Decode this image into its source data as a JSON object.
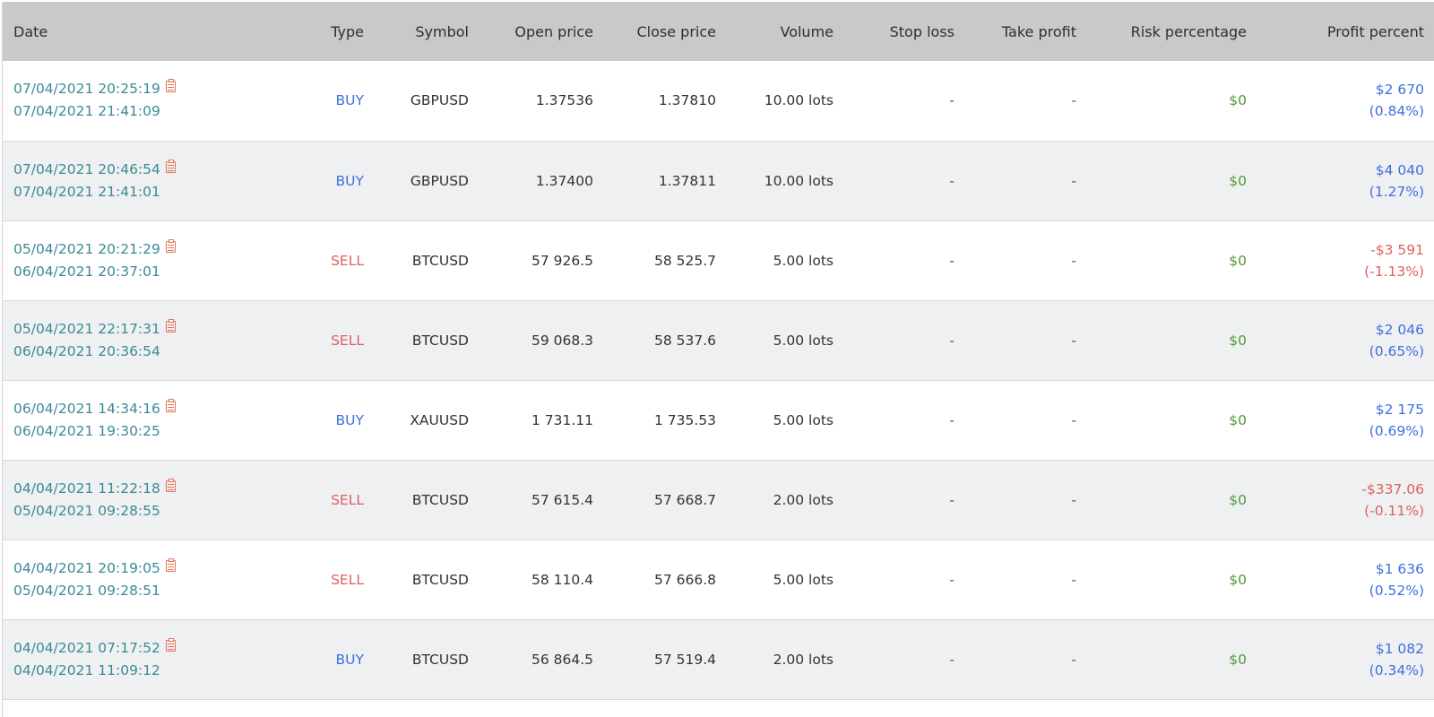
{
  "headers": {
    "date": "Date",
    "type": "Type",
    "symbol": "Symbol",
    "open_price": "Open price",
    "close_price": "Close price",
    "volume": "Volume",
    "stop_loss": "Stop loss",
    "take_profit": "Take profit",
    "risk": "Risk percentage",
    "profit": "Profit percent"
  },
  "colors": {
    "buy": "#3f6fe0",
    "sell": "#e06060",
    "risk": "#4f9a3a",
    "date": "#3b8a96",
    "header_bg": "#c9c9c9",
    "row_alt_bg": "#eff0f1"
  },
  "icons": {
    "date_icon": "document-icon"
  },
  "rows": [
    {
      "open_date": "07/04/2021 20:25:19",
      "close_date": "07/04/2021 21:41:09",
      "type": "BUY",
      "symbol": "GBPUSD",
      "open_price": "1.37536",
      "close_price": "1.37810",
      "volume": "10.00 lots",
      "stop_loss": "-",
      "take_profit": "-",
      "risk": "$0",
      "profit": "$2 670",
      "profit_pct": "(0.84%)"
    },
    {
      "open_date": "07/04/2021 20:46:54",
      "close_date": "07/04/2021 21:41:01",
      "type": "BUY",
      "symbol": "GBPUSD",
      "open_price": "1.37400",
      "close_price": "1.37811",
      "volume": "10.00 lots",
      "stop_loss": "-",
      "take_profit": "-",
      "risk": "$0",
      "profit": "$4 040",
      "profit_pct": "(1.27%)"
    },
    {
      "open_date": "05/04/2021 20:21:29",
      "close_date": "06/04/2021 20:37:01",
      "type": "SELL",
      "symbol": "BTCUSD",
      "open_price": "57 926.5",
      "close_price": "58 525.7",
      "volume": "5.00 lots",
      "stop_loss": "-",
      "take_profit": "-",
      "risk": "$0",
      "profit": "-$3 591",
      "profit_pct": "(-1.13%)"
    },
    {
      "open_date": "05/04/2021 22:17:31",
      "close_date": "06/04/2021 20:36:54",
      "type": "SELL",
      "symbol": "BTCUSD",
      "open_price": "59 068.3",
      "close_price": "58 537.6",
      "volume": "5.00 lots",
      "stop_loss": "-",
      "take_profit": "-",
      "risk": "$0",
      "profit": "$2 046",
      "profit_pct": "(0.65%)"
    },
    {
      "open_date": "06/04/2021 14:34:16",
      "close_date": "06/04/2021 19:30:25",
      "type": "BUY",
      "symbol": "XAUUSD",
      "open_price": "1 731.11",
      "close_price": "1 735.53",
      "volume": "5.00 lots",
      "stop_loss": "-",
      "take_profit": "-",
      "risk": "$0",
      "profit": "$2 175",
      "profit_pct": "(0.69%)"
    },
    {
      "open_date": "04/04/2021 11:22:18",
      "close_date": "05/04/2021 09:28:55",
      "type": "SELL",
      "symbol": "BTCUSD",
      "open_price": "57 615.4",
      "close_price": "57 668.7",
      "volume": "2.00 lots",
      "stop_loss": "-",
      "take_profit": "-",
      "risk": "$0",
      "profit": "-$337.06",
      "profit_pct": "(-0.11%)"
    },
    {
      "open_date": "04/04/2021 20:19:05",
      "close_date": "05/04/2021 09:28:51",
      "type": "SELL",
      "symbol": "BTCUSD",
      "open_price": "58 110.4",
      "close_price": "57 666.8",
      "volume": "5.00 lots",
      "stop_loss": "-",
      "take_profit": "-",
      "risk": "$0",
      "profit": "$1 636",
      "profit_pct": "(0.52%)"
    },
    {
      "open_date": "04/04/2021 07:17:52",
      "close_date": "04/04/2021 11:09:12",
      "type": "BUY",
      "symbol": "BTCUSD",
      "open_price": "56 864.5",
      "close_price": "57 519.4",
      "volume": "2.00 lots",
      "stop_loss": "-",
      "take_profit": "-",
      "risk": "$0",
      "profit": "$1 082",
      "profit_pct": "(0.34%)"
    }
  ]
}
